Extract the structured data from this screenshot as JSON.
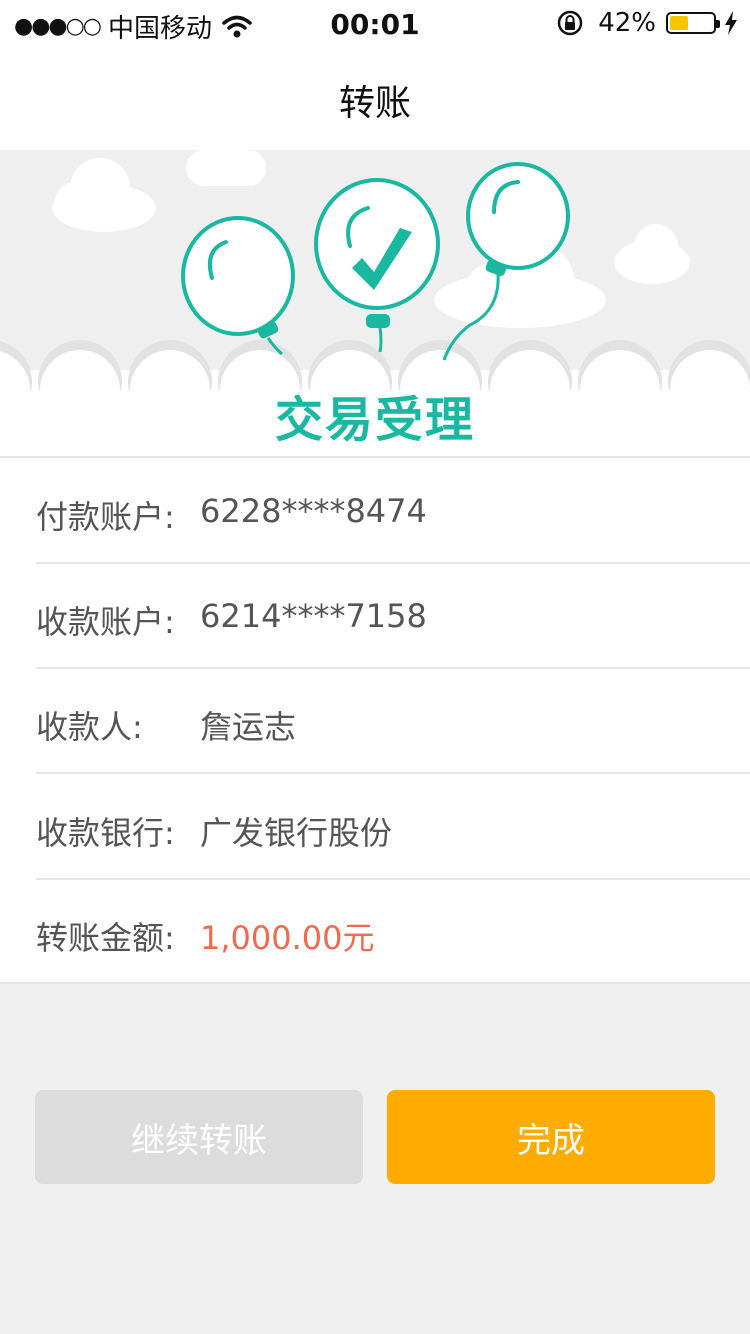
{
  "status_bar": {
    "carrier": "中国移动",
    "time": "00:01",
    "battery_percent": "42%",
    "battery_level": 0.42
  },
  "nav": {
    "title": "转账"
  },
  "hero": {
    "title": "交易受理",
    "accent_color": "#1ab8a0"
  },
  "details": {
    "rows": [
      {
        "label": "付款账户:",
        "value": "6228****8474"
      },
      {
        "label": "收款账户:",
        "value": "6214****7158"
      },
      {
        "label": "收款人:",
        "value": "詹运志"
      },
      {
        "label": "收款银行:",
        "value": "广发银行股份"
      },
      {
        "label": "转账金额:",
        "value": "1,000.00元"
      }
    ]
  },
  "buttons": {
    "continue_label": "继续转账",
    "done_label": "完成",
    "done_color": "#ffab00",
    "continue_color": "#dcdcdc"
  }
}
